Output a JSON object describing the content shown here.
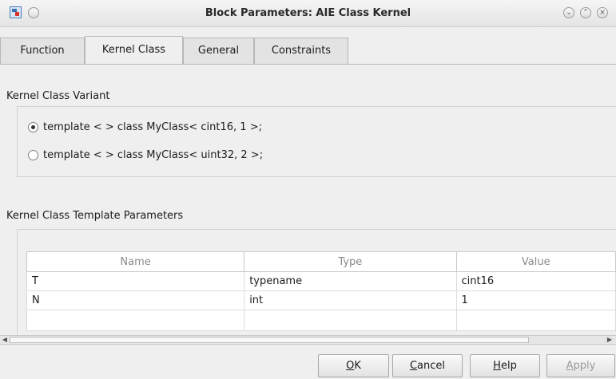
{
  "window": {
    "title": "Block Parameters: AIE Class Kernel",
    "controls": [
      "minimize-icon",
      "maximize-icon",
      "close-icon"
    ]
  },
  "tabs": [
    {
      "label": "Function",
      "active": false
    },
    {
      "label": "Kernel Class",
      "active": true
    },
    {
      "label": "General",
      "active": false
    },
    {
      "label": "Constraints",
      "active": false
    }
  ],
  "variant": {
    "heading": "Kernel Class Variant",
    "options": [
      {
        "label": "template < > class MyClass< cint16, 1 >;",
        "selected": true
      },
      {
        "label": "template < > class MyClass< uint32, 2 >;",
        "selected": false
      }
    ]
  },
  "template_params": {
    "heading": "Kernel Class Template Parameters",
    "columns": [
      "Name",
      "Type",
      "Value"
    ],
    "rows": [
      [
        "T",
        "typename",
        "cint16"
      ],
      [
        "N",
        "int",
        "1"
      ]
    ]
  },
  "buttons": {
    "ok_mnemonic": "O",
    "ok_rest": "K",
    "cancel_mnemonic": "C",
    "cancel_rest": "ancel",
    "help_mnemonic": "H",
    "help_rest": "elp",
    "apply_mnemonic": "A",
    "apply_rest": "pply"
  }
}
